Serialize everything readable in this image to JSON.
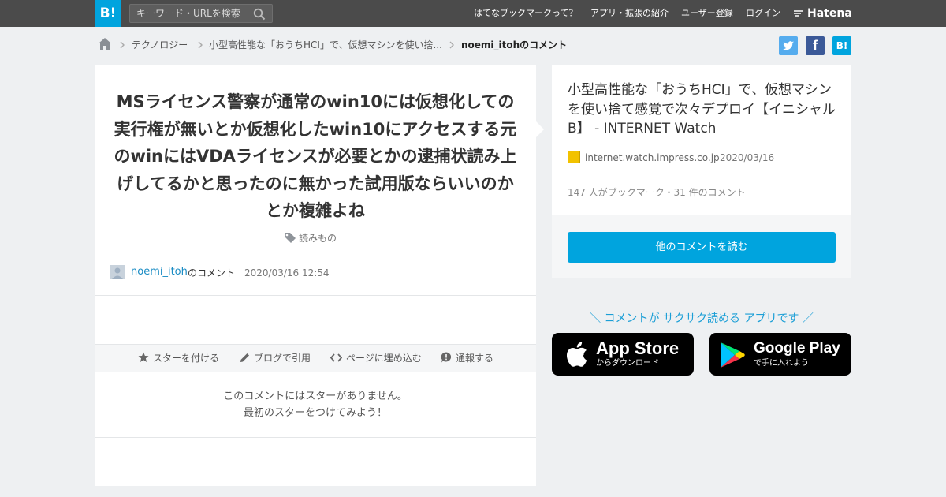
{
  "header": {
    "logo": "B!",
    "search_placeholder": "キーワード・URLを検索",
    "nav": [
      "はてなブックマークって？",
      "アプリ・拡張の紹介",
      "ユーザー登録",
      "ログイン"
    ],
    "hatena": "Hatena"
  },
  "breadcrumb": {
    "items": [
      "テクノロジー",
      "小型高性能な「おうちHCI」で、仮想マシンを使い捨...",
      "noemi_itohのコメント"
    ]
  },
  "share": {
    "twitter": "",
    "facebook": "f",
    "hatebu": "B!"
  },
  "comment": {
    "text": "MSライセンス警察が通常のwin10には仮想化しての実行権が無いとか仮想化したwin10にアクセスする元のwinにはVDAライセンスが必要とかの逮捕状読み上げしてるかと思ったのに無かった試用版ならいいのかとか複雑よね",
    "tag": "読みもの",
    "user": "noemi_itoh",
    "user_suffix": "のコメント",
    "date": "2020/03/16 12:54"
  },
  "actions": [
    "スターを付ける",
    "ブログで引用",
    "ページに埋め込む",
    "通報する"
  ],
  "no_star": {
    "line1": "このコメントにはスターがありません。",
    "line2": "最初のスターをつけてみよう！"
  },
  "entry": {
    "title": "小型高性能な「おうちHCI」で、仮想マシンを使い捨て感覚で次々デプロイ【イニシャルB】 - INTERNET Watch",
    "domain": "internet.watch.impress.co.jp",
    "date": "2020/03/16",
    "stats": "147 人がブックマーク・31 件のコメント",
    "more_button": "他のコメントを読む"
  },
  "app_promo": {
    "text": "＼ コメントが サクサク読める アプリです ／",
    "app_store_big": "App Store",
    "app_store_small": "からダウンロード",
    "google_play_big": "Google Play",
    "google_play_small": "で手に入れよう"
  },
  "colors": {
    "brand": "#00a4de",
    "header_bg": "#4b4b4b",
    "page_bg": "#eef0f2",
    "twitter": "#55acee",
    "facebook": "#3b5998",
    "link": "#1a8cc4"
  },
  "icons": [
    "search-icon",
    "home-icon",
    "chevron-right-icon",
    "twitter-icon",
    "facebook-icon",
    "hatebu-icon",
    "tag-icon",
    "star-icon",
    "pencil-icon",
    "code-icon",
    "alert-icon",
    "apple-icon",
    "google-play-icon",
    "hatena-icon"
  ]
}
